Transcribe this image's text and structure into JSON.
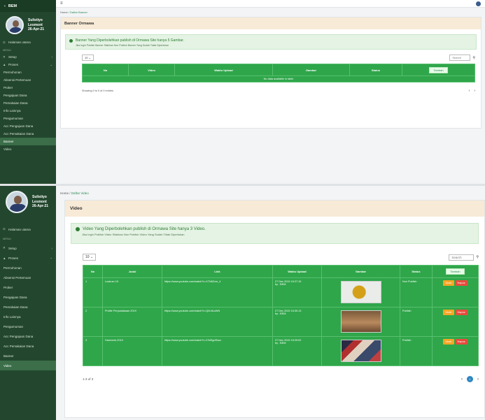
{
  "sidebar": {
    "brand": "BEM",
    "user": {
      "name_line1": "Sulistiyo",
      "name_line2": "Lesmont",
      "date": "26-Apr-21"
    },
    "home": "Halaman utama",
    "menu_heading": "MENU",
    "items": [
      {
        "label": "Setup",
        "icon": "tools-icon",
        "arrow": "‹"
      },
      {
        "label": "Proses",
        "icon": "graph-icon",
        "arrow": "⌄"
      }
    ],
    "subitems": [
      "Permohonan",
      "Absensi Pertemuan",
      "Proker",
      "Pengajuan Dana",
      "Pemakaian Dana",
      "Info Lainnya",
      "Pengumuman",
      "Acc Pengajuan Dana",
      "Acc Pemakaian Dana",
      "Banner",
      "Video"
    ]
  },
  "shotA": {
    "breadcrumb": {
      "home": "Home",
      "sep": "/",
      "current": "Daftar Banner"
    },
    "title": "Banner Ormawa",
    "alert_main": "Banner Yang Diperbolehkan publish di Ormawa Site hanya 5 Gambar.",
    "alert_sub": "Jika Ingin Publish Banner Silahkan Non Publish Banner Yang Sudah Tidak Diperlukan",
    "page_size": "10",
    "search_placeholder": "Search",
    "columns": [
      "No",
      "Video",
      "Waktu Upload",
      "Gambar",
      "Status"
    ],
    "add_label": "Tambah",
    "empty": "No data available in table",
    "info": "Showing 0 to 0 of 0 entries",
    "prev": "‹",
    "next": "›"
  },
  "shotB": {
    "breadcrumb": {
      "home": "Home",
      "sep": "/",
      "current": "Daftar Video"
    },
    "title": "Video",
    "alert_main": "Video Yang Diperbolehkan publish di Ormawa Site hanya 3 Video.",
    "alert_sub": "Jika Ingin Publish Video Silahkan Non Publish Video Yang Sudah Tidak Diperlukan",
    "page_size": "10",
    "search_placeholder": "Search",
    "columns": [
      "No",
      "Judul",
      "Link",
      "Waktu Upload",
      "Gambar",
      "Status"
    ],
    "add_label": "Tambah",
    "edit_label": "Ubah",
    "delete_label": "Hapus",
    "rows": [
      {
        "no": "1",
        "judul": "Lustrum 15",
        "link": "https://www.youtube.com/watch?v=1TN6Zvm_4",
        "waktu": "27 Dec 2019 15:27:15",
        "by": "by : BEM",
        "status": "Non Publish"
      },
      {
        "no": "2",
        "judul": "Profile Perpustakaan 2019",
        "link": "https://www.youtube.com/watch?v=QM-8LsWN",
        "waktu": "27 Dec 2019 15:30:13",
        "by": "by : BEM",
        "status": "Publish"
      },
      {
        "no": "3",
        "judul": "Harmonis 2019",
        "link": "https://www.youtube.com/watch?v=1TaRgoRaxc",
        "waktu": "27 Dec 2019 15:29:02",
        "by": "by : BEM",
        "status": "Publish"
      }
    ],
    "info": "1-3 of 3",
    "prev": "‹",
    "page": "1",
    "next": "›"
  }
}
